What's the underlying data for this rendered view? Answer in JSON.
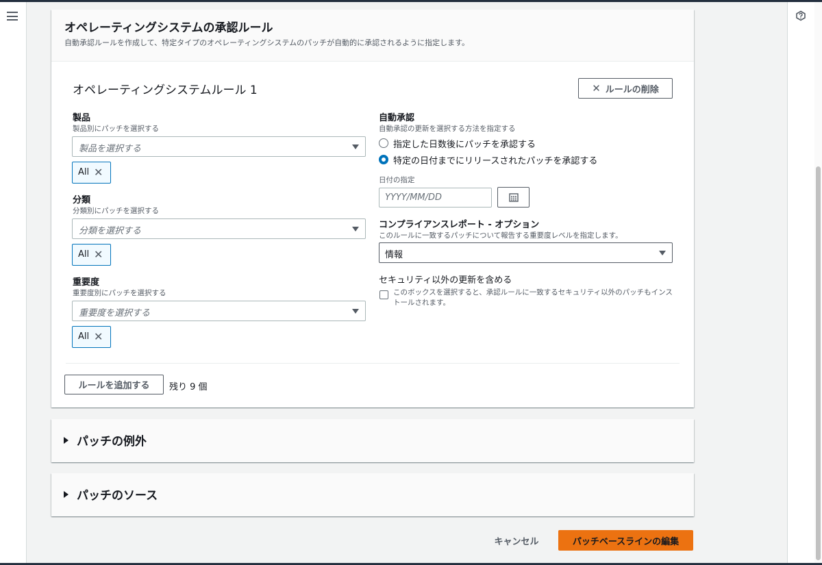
{
  "os_rules": {
    "title": "オペレーティングシステムの承認ルール",
    "description": "自動承認ルールを作成して、特定タイプのオペレーティングシステムのパッチが自動的に承認されるように指定します。",
    "rule": {
      "title": "オペレーティングシステムルール 1",
      "remove_label": "ルールの削除",
      "product": {
        "label": "製品",
        "description": "製品別にパッチを選択する",
        "placeholder": "製品を選択する",
        "token": "All"
      },
      "classification": {
        "label": "分類",
        "description": "分類別にパッチを選択する",
        "placeholder": "分類を選択する",
        "token": "All"
      },
      "severity": {
        "label": "重要度",
        "description": "重要度別にパッチを選択する",
        "placeholder": "重要度を選択する",
        "token": "All"
      },
      "auto_approval": {
        "label": "自動承認",
        "description": "自動承認の更新を選択する方法を指定する",
        "options": [
          {
            "label": "指定した日数後にパッチを承認する",
            "selected": false
          },
          {
            "label": "特定の日付までにリリースされたパッチを承認する",
            "selected": true
          }
        ]
      },
      "date": {
        "label": "日付の指定",
        "placeholder": "YYYY/MM/DD"
      },
      "compliance": {
        "label": "コンプライアンスレポート - オプション",
        "description": "このルールに一致するパッチについて報告する重要度レベルを指定します。",
        "value": "情報"
      },
      "non_security": {
        "label": "セキュリティ以外の更新を含める",
        "checkbox_text": "このボックスを選択すると、承認ルールに一致するセキュリティ以外のパッチもインストールされます。",
        "checked": false
      }
    },
    "add_rule_label": "ルールを追加する",
    "remaining": "残り 9 個"
  },
  "sections": {
    "exceptions": "パッチの例外",
    "sources": "パッチのソース"
  },
  "footer": {
    "cancel": "キャンセル",
    "submit": "パッチベースラインの編集"
  },
  "colors": {
    "primary": "#ec7211",
    "selected": "#0073bb"
  },
  "icons": [
    "menu-icon",
    "help-icon",
    "close-icon",
    "caret-down-icon",
    "calendar-icon",
    "expand-triangle-icon"
  ]
}
